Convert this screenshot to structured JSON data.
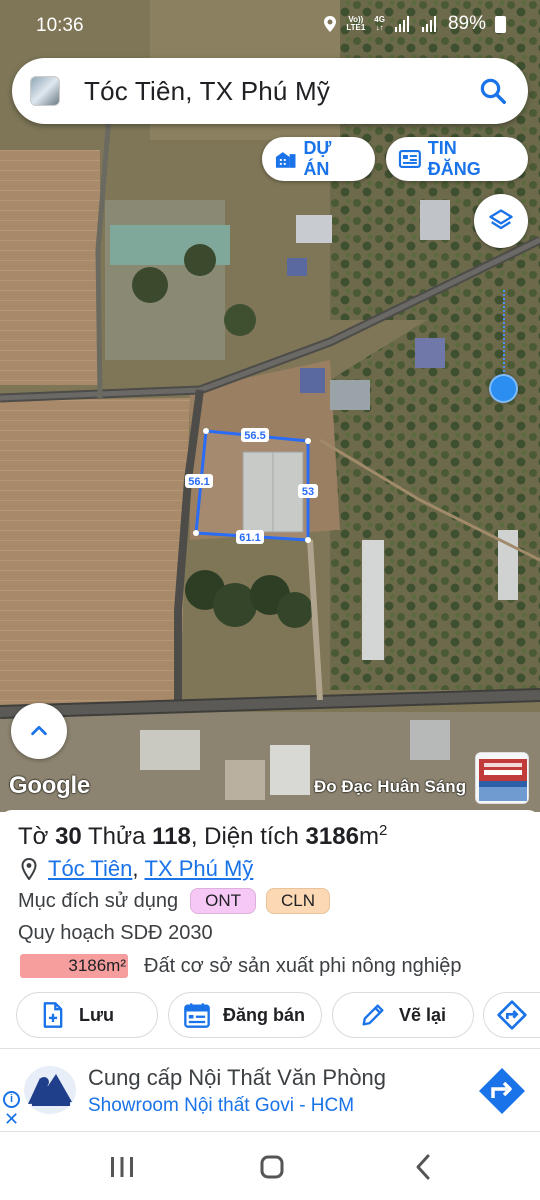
{
  "status_bar": {
    "time": "10:36",
    "network_volte": "Vo))",
    "network_lte": "LTE1",
    "network_4g": "4G",
    "battery": "89%"
  },
  "search": {
    "query": "Tóc Tiên, TX Phú Mỹ"
  },
  "map_chips": {
    "du_an": "DỰ ÁN",
    "tin_dang": "TIN ĐĂNG"
  },
  "map": {
    "edge_top": "56.5",
    "edge_left": "56.1",
    "edge_right": "53",
    "edge_bottom": "61.1",
    "google_logo": "Google",
    "watermark": "Đo Đạc Huân Sáng",
    "parcel_outline_color": "#2a6cf5"
  },
  "parcel": {
    "prefix_to": "Tờ ",
    "to_number": "30",
    "prefix_thua": " Thửa ",
    "thua_number": "118",
    "prefix_area": ", Diện tích ",
    "area_value": "3186",
    "area_unit": "m",
    "area_unit_sup": "2",
    "location_commune": "Tóc Tiên",
    "location_separator": ",",
    "location_town": "TX Phú Mỹ",
    "purpose_label": "Mục đích sử dụng",
    "purpose_badges": [
      "ONT",
      "CLN"
    ],
    "plan_label": "Quy hoạch SDĐ 2030",
    "plan_area": "3186m²",
    "plan_description": "Đất cơ sở sản xuất phi nông nghiệp"
  },
  "actions": {
    "luu": "Lưu",
    "dang_ban": "Đăng bán",
    "ve_lai": "Vẽ lại"
  },
  "ad": {
    "title": "Cung cấp Nội Thất Văn Phòng",
    "subtitle": "Showroom Nội thất Govi - HCM",
    "info_glyph": "i",
    "close_glyph": "✕"
  },
  "colors": {
    "accent": "#1a73e8",
    "badge_ont": "#f6c8f5",
    "badge_cln": "#fcd9b4",
    "plan_bar": "#f69d9d",
    "location_dot": "#2b8ef0"
  }
}
